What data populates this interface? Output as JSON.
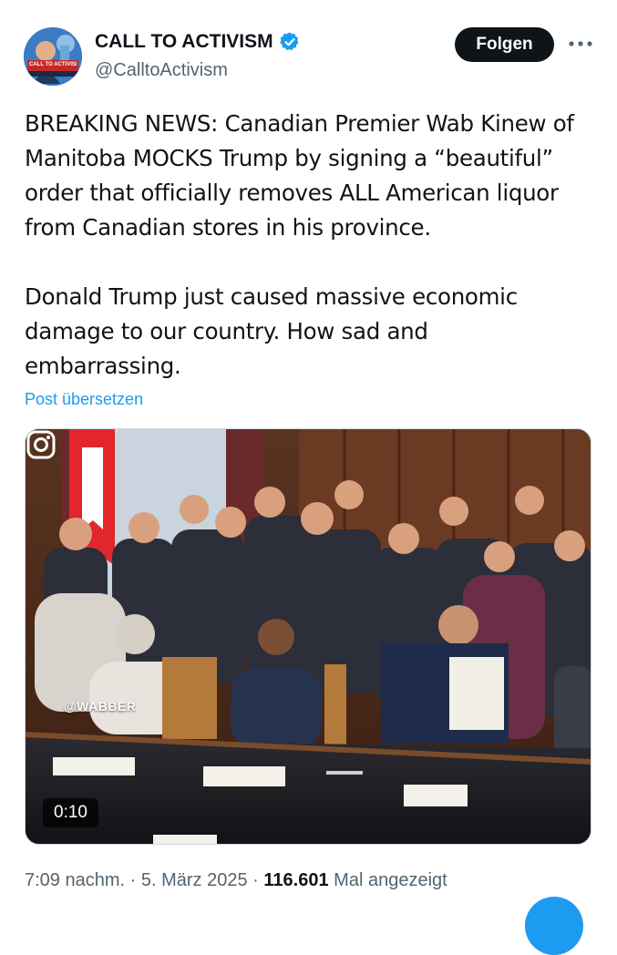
{
  "author": {
    "display_name": "CALL TO ACTIVISM",
    "handle": "@CalltoActivism",
    "avatar_text": "CALL TO ACTIVISM"
  },
  "actions": {
    "follow_label": "Folgen",
    "more_icon": "more-horizontal-icon"
  },
  "tweet": {
    "text": "BREAKING NEWS: Canadian Premier Wab Kinew of\nManitoba MOCKS Trump by signing a “beautiful”\norder that officially removes ALL American liquor\nfrom Canadian stores in his province.\n\nDonald Trump just caused massive economic\ndamage to our country. How sad and\nembarrassing.",
    "translate_label": "Post übersetzen"
  },
  "media": {
    "watermark": "@WABBER",
    "duration": "0:10",
    "overlay_icon": "instagram-icon"
  },
  "meta": {
    "time": "7:09 nachm.",
    "separator": "·",
    "date": "5. März 2025",
    "views": "116.601",
    "views_label": "Mal angezeigt"
  },
  "colors": {
    "accent": "#1d9bf0",
    "text": "#0f1419",
    "secondary": "#536471",
    "follow_bg": "#0f1419"
  }
}
